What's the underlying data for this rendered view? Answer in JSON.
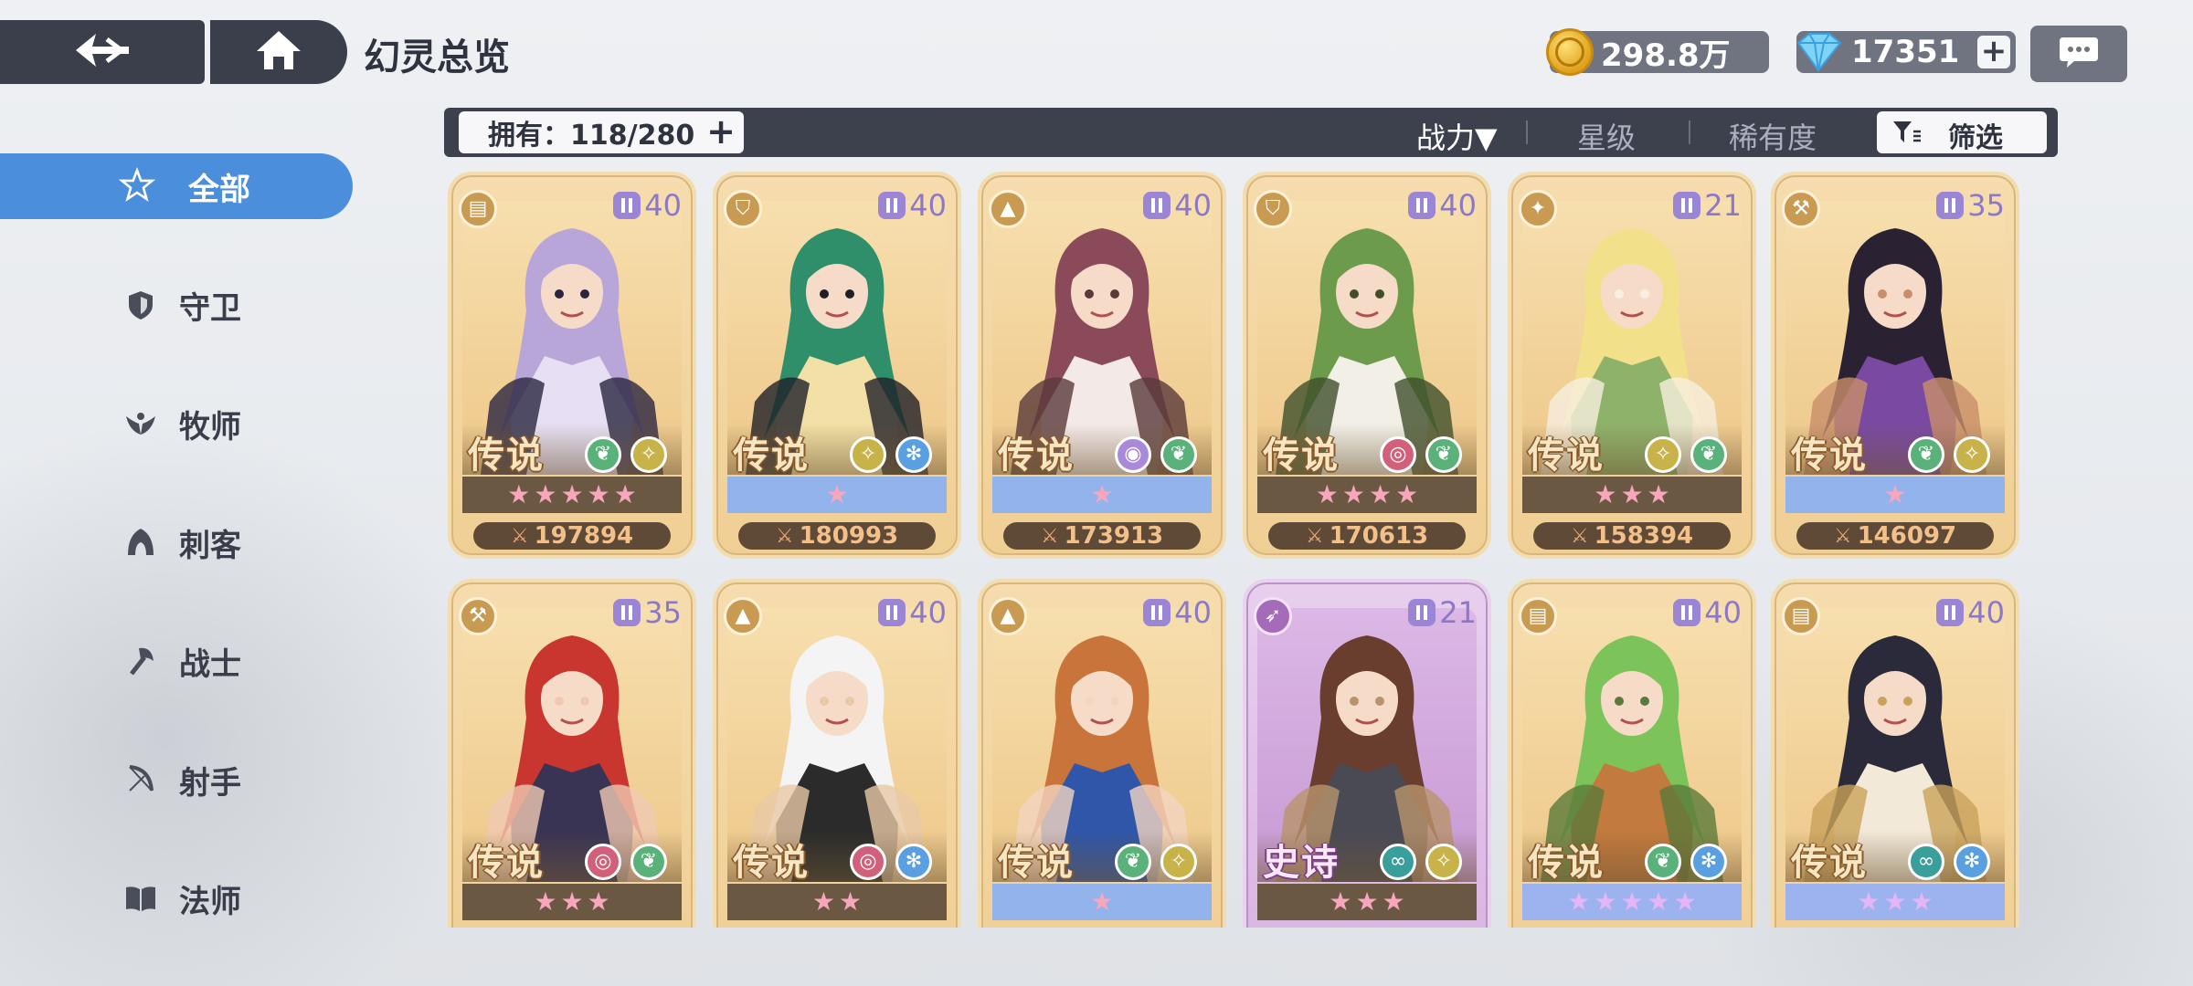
{
  "header": {
    "title": "幻灵总览",
    "coins": "298.8万",
    "gems": "17351",
    "gem_plus": "+"
  },
  "sidebar": {
    "items": [
      {
        "label": "全部",
        "icon": "all-icon",
        "active": true
      },
      {
        "label": "守卫",
        "icon": "shield-icon"
      },
      {
        "label": "牧师",
        "icon": "wings-icon"
      },
      {
        "label": "刺客",
        "icon": "hood-icon"
      },
      {
        "label": "战士",
        "icon": "axe-icon"
      },
      {
        "label": "射手",
        "icon": "bow-icon"
      },
      {
        "label": "法师",
        "icon": "book-icon"
      }
    ]
  },
  "filter": {
    "owned": "拥有：118/280",
    "owned_plus": "+",
    "sort_power": "战力▼",
    "sort_star": "星级",
    "sort_rarity": "稀有度",
    "filter_label": "筛选"
  },
  "colors": {
    "accent": "#4b8fdc",
    "dark_panel": "#3d404d",
    "legend_card": "#f0cf94",
    "epic_card": "#d9b5e2"
  },
  "cards": [
    {
      "rarity": "传说",
      "role": "book-icon",
      "level": "40",
      "stars": 5,
      "star_bar": "brown",
      "power": "197894",
      "elements": [
        "leaf-icon",
        "wings-icon"
      ],
      "palette": [
        "#b9a6d8",
        "#e7dff3",
        "#2b2540"
      ]
    },
    {
      "rarity": "传说",
      "role": "shield-icon",
      "level": "40",
      "stars": 1,
      "star_bar": "blue",
      "power": "180993",
      "elements": [
        "wings-icon",
        "snow-icon"
      ],
      "palette": [
        "#2f8f6a",
        "#f2e0a6",
        "#1f1f28"
      ]
    },
    {
      "rarity": "传说",
      "role": "hood-icon",
      "level": "40",
      "stars": 1,
      "star_bar": "blue",
      "power": "173913",
      "elements": [
        "eye-icon",
        "leaf-icon"
      ],
      "palette": [
        "#8b4a5a",
        "#f3e9e6",
        "#5a3a3a"
      ]
    },
    {
      "rarity": "传说",
      "role": "shield-icon",
      "level": "40",
      "stars": 4,
      "star_bar": "brown",
      "power": "170613",
      "elements": [
        "swirl-icon",
        "leaf-icon"
      ],
      "palette": [
        "#6c9b4c",
        "#f1efe6",
        "#3e4f2a"
      ]
    },
    {
      "rarity": "传说",
      "role": "wings-icon",
      "level": "21",
      "stars": 3,
      "star_bar": "brown",
      "power": "158394",
      "elements": [
        "wings-icon",
        "leaf-icon"
      ],
      "palette": [
        "#f2e08a",
        "#8fb26a",
        "#f7efe0"
      ]
    },
    {
      "rarity": "传说",
      "role": "axe-icon",
      "level": "35",
      "stars": 1,
      "star_bar": "blue",
      "power": "146097",
      "elements": [
        "leaf-icon",
        "wings-icon"
      ],
      "palette": [
        "#2a2233",
        "#7a4aa2",
        "#c98e6a"
      ]
    },
    {
      "rarity": "传说",
      "role": "axe-icon",
      "level": "35",
      "stars": 3,
      "star_bar": "brown",
      "power": "",
      "elements": [
        "swirl-icon",
        "leaf-icon"
      ],
      "palette": [
        "#c8362f",
        "#3a3454",
        "#f0c9b2"
      ]
    },
    {
      "rarity": "传说",
      "role": "hood-icon",
      "level": "40",
      "stars": 2,
      "star_bar": "brown",
      "power": "",
      "elements": [
        "swirl-icon",
        "snow-icon"
      ],
      "palette": [
        "#f4f4f4",
        "#2b2b2b",
        "#e9c9a6"
      ]
    },
    {
      "rarity": "传说",
      "role": "hood-icon",
      "level": "40",
      "stars": 1,
      "star_bar": "blue",
      "power": "",
      "elements": [
        "leaf-icon",
        "wings-icon"
      ],
      "palette": [
        "#c8743a",
        "#2f56a8",
        "#f3d5c0"
      ]
    },
    {
      "rarity": "史诗",
      "role": "bow-icon",
      "level": "21",
      "stars": 3,
      "star_bar": "brown",
      "power": "",
      "elements": [
        "wave-icon",
        "wings-icon"
      ],
      "palette": [
        "#6a3e2e",
        "#4a4a55",
        "#b9936b"
      ]
    },
    {
      "rarity": "传说",
      "role": "book-icon",
      "level": "40",
      "stars": 5,
      "star_bar": "violet",
      "power": "",
      "elements": [
        "leaf-icon",
        "snow-icon"
      ],
      "palette": [
        "#7cc45a",
        "#c27a3e",
        "#5a7a3a"
      ]
    },
    {
      "rarity": "传说",
      "role": "book-icon",
      "level": "40",
      "stars": 3,
      "star_bar": "violet",
      "power": "",
      "elements": [
        "wave-icon",
        "snow-icon"
      ],
      "palette": [
        "#2a2a3a",
        "#f2e9d8",
        "#c9a35a"
      ]
    }
  ]
}
